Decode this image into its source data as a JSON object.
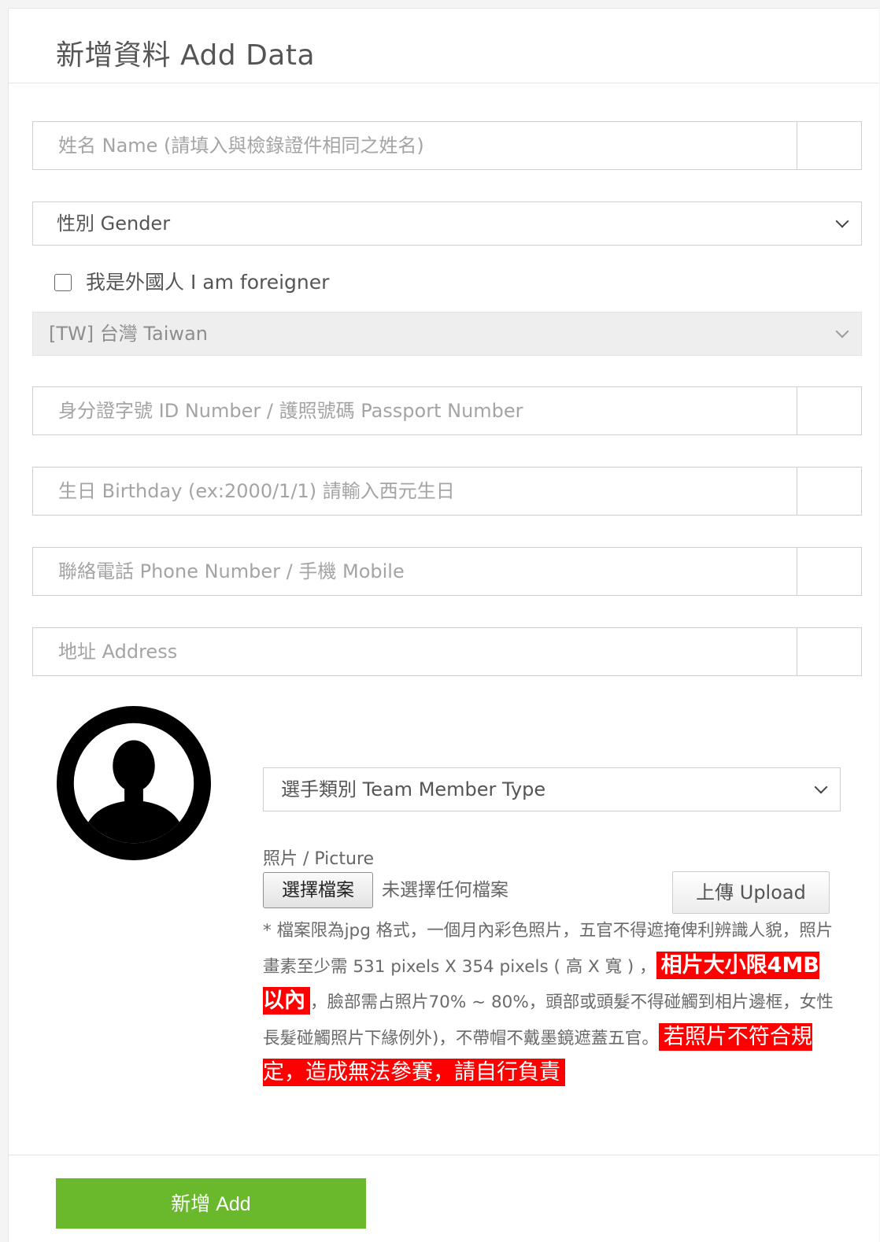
{
  "header": {
    "title": "新增資料 Add Data"
  },
  "form": {
    "name_placeholder": "姓名 Name (請填入與檢錄證件相同之姓名)",
    "gender_value": "性別 Gender",
    "foreigner_label": "我是外國人 I am foreigner",
    "foreigner_checked": false,
    "country_value": "[TW] 台灣 Taiwan",
    "id_placeholder": "身分證字號 ID Number / 護照號碼 Passport Number",
    "birthday_placeholder": "生日 Birthday (ex:2000/1/1) 請輸入西元生日",
    "phone_placeholder": "聯絡電話 Phone Number / 手機 Mobile",
    "address_placeholder": "地址 Address",
    "member_type_value": "選手類別 Team Member Type"
  },
  "photo": {
    "label": "照片 / Picture",
    "choose_file_label": "選擇檔案",
    "no_file_text": "未選擇任何檔案",
    "upload_label": "上傳 Upload",
    "note_part1": "* 檔案限為jpg 格式，一個月內彩色照片，五官不得遮掩俾利辨識人貌，照片畫素至少需 531 pixels X 354 pixels ( 高 X 寬 ) ，",
    "note_highlight1": "相片大小限4MB以內",
    "note_part2": "，臉部需占照片70% ~ 80%，頭部或頭髮不得碰觸到相片邊框，女性長髮碰觸照片下緣例外)，不帶帽不戴墨鏡遮蓋五官。",
    "note_highlight2": "若照片不符合規定，造成無法參賽，請自行負責"
  },
  "actions": {
    "add_label": "新增 Add"
  },
  "colors": {
    "add_button": "#6ab92c",
    "highlight": "#ff0000"
  }
}
